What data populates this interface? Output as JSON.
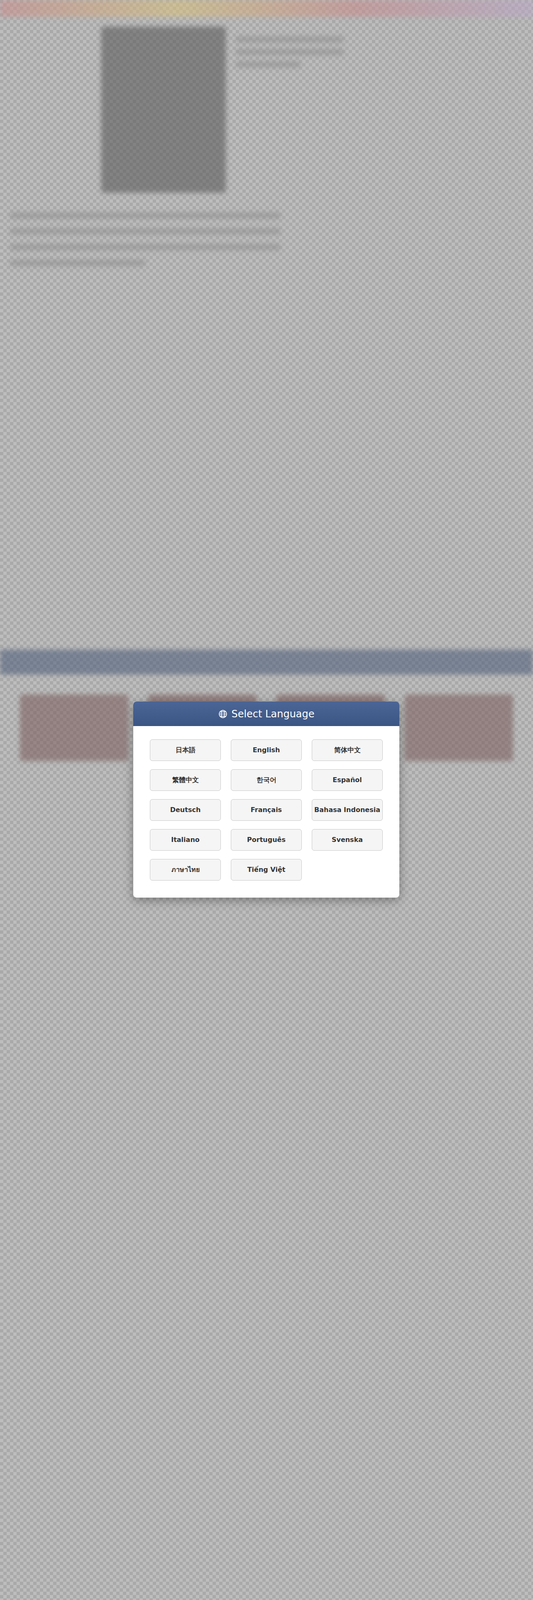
{
  "modal": {
    "title": "Select Language",
    "languages": [
      {
        "label": "日本語"
      },
      {
        "label": "English"
      },
      {
        "label": "简体中文"
      },
      {
        "label": "繁體中文"
      },
      {
        "label": "한국어"
      },
      {
        "label": "Español"
      },
      {
        "label": "Deutsch"
      },
      {
        "label": "Français"
      },
      {
        "label": "Bahasa Indonesia"
      },
      {
        "label": "Italiano"
      },
      {
        "label": "Português"
      },
      {
        "label": "Svenska"
      },
      {
        "label": "ภาษาไทย"
      },
      {
        "label": "Tiếng Việt"
      }
    ]
  }
}
